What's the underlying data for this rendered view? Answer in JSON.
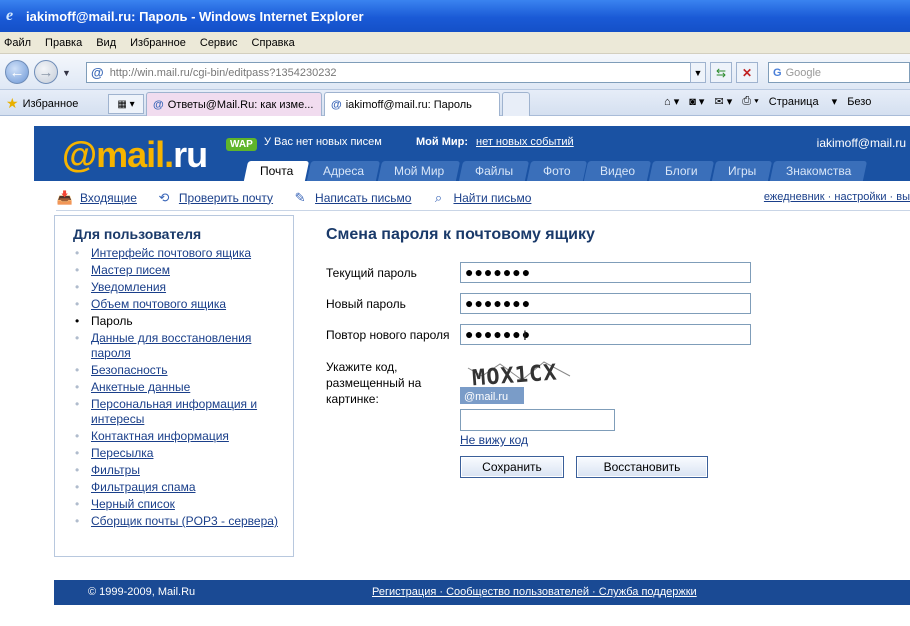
{
  "window": {
    "title": "iakimoff@mail.ru: Пароль - Windows Internet Explorer"
  },
  "menu": [
    "Файл",
    "Правка",
    "Вид",
    "Избранное",
    "Сервис",
    "Справка"
  ],
  "address": {
    "url": "http://win.mail.ru/cgi-bin/editpass?1354230232",
    "search_placeholder": "Google"
  },
  "favorites_label": "Избранное",
  "tabs": [
    "Ответы@Mail.Ru: как изме...",
    "iakimoff@mail.ru: Пароль"
  ],
  "commands": {
    "page": "Страница",
    "more": "Безо"
  },
  "header": {
    "logo": "@mail.",
    "logo_ru": "ru",
    "wap": "WAP",
    "no_letters": "У Вас нет новых писем",
    "my_world": "Мой Мир:",
    "no_events": "нет новых событий",
    "user": "iakimoff@mail.ru",
    "nav": [
      "Почта",
      "Адреса",
      "Мой Мир",
      "Файлы",
      "Фото",
      "Видео",
      "Блоги",
      "Игры",
      "Знакомства"
    ]
  },
  "subnav": {
    "items": [
      "Входящие",
      "Проверить почту",
      "Написать письмо",
      "Найти письмо"
    ],
    "right": "ежедневник · настройки · вы"
  },
  "sidebar": {
    "title": "Для пользователя",
    "items": [
      "Интерфейс почтового ящика",
      "Мастер писем",
      "Уведомления",
      "Объем почтового ящика",
      "Пароль",
      "Данные для восстановления пароля",
      "Безопасность",
      "Анкетные данные",
      "Персональная информация и интересы",
      "Контактная информация",
      "Пересылка",
      "Фильтры",
      "Фильтрация спама",
      "Черный список",
      "Сборщик почты (POP3 - сервера)"
    ]
  },
  "form": {
    "title": "Смена пароля к почтовому ящику",
    "current_label": "Текущий пароль",
    "current_value": "●●●●●●●",
    "new_label": "Новый пароль",
    "new_value": "●●●●●●●",
    "repeat_label": "Повтор нового пароля",
    "repeat_value": "●●●●●●●",
    "captcha_label": "Укажите код, размещенный на картинке:",
    "captcha_text": "MOX1CX",
    "captcha_brand": "@mail.ru",
    "no_see": "Не вижу код",
    "save": "Сохранить",
    "restore": "Восстановить"
  },
  "footer": {
    "copy": "© 1999-2009, Mail.Ru",
    "links": "Регистрация · Сообщество пользователей · Служба поддержки"
  }
}
